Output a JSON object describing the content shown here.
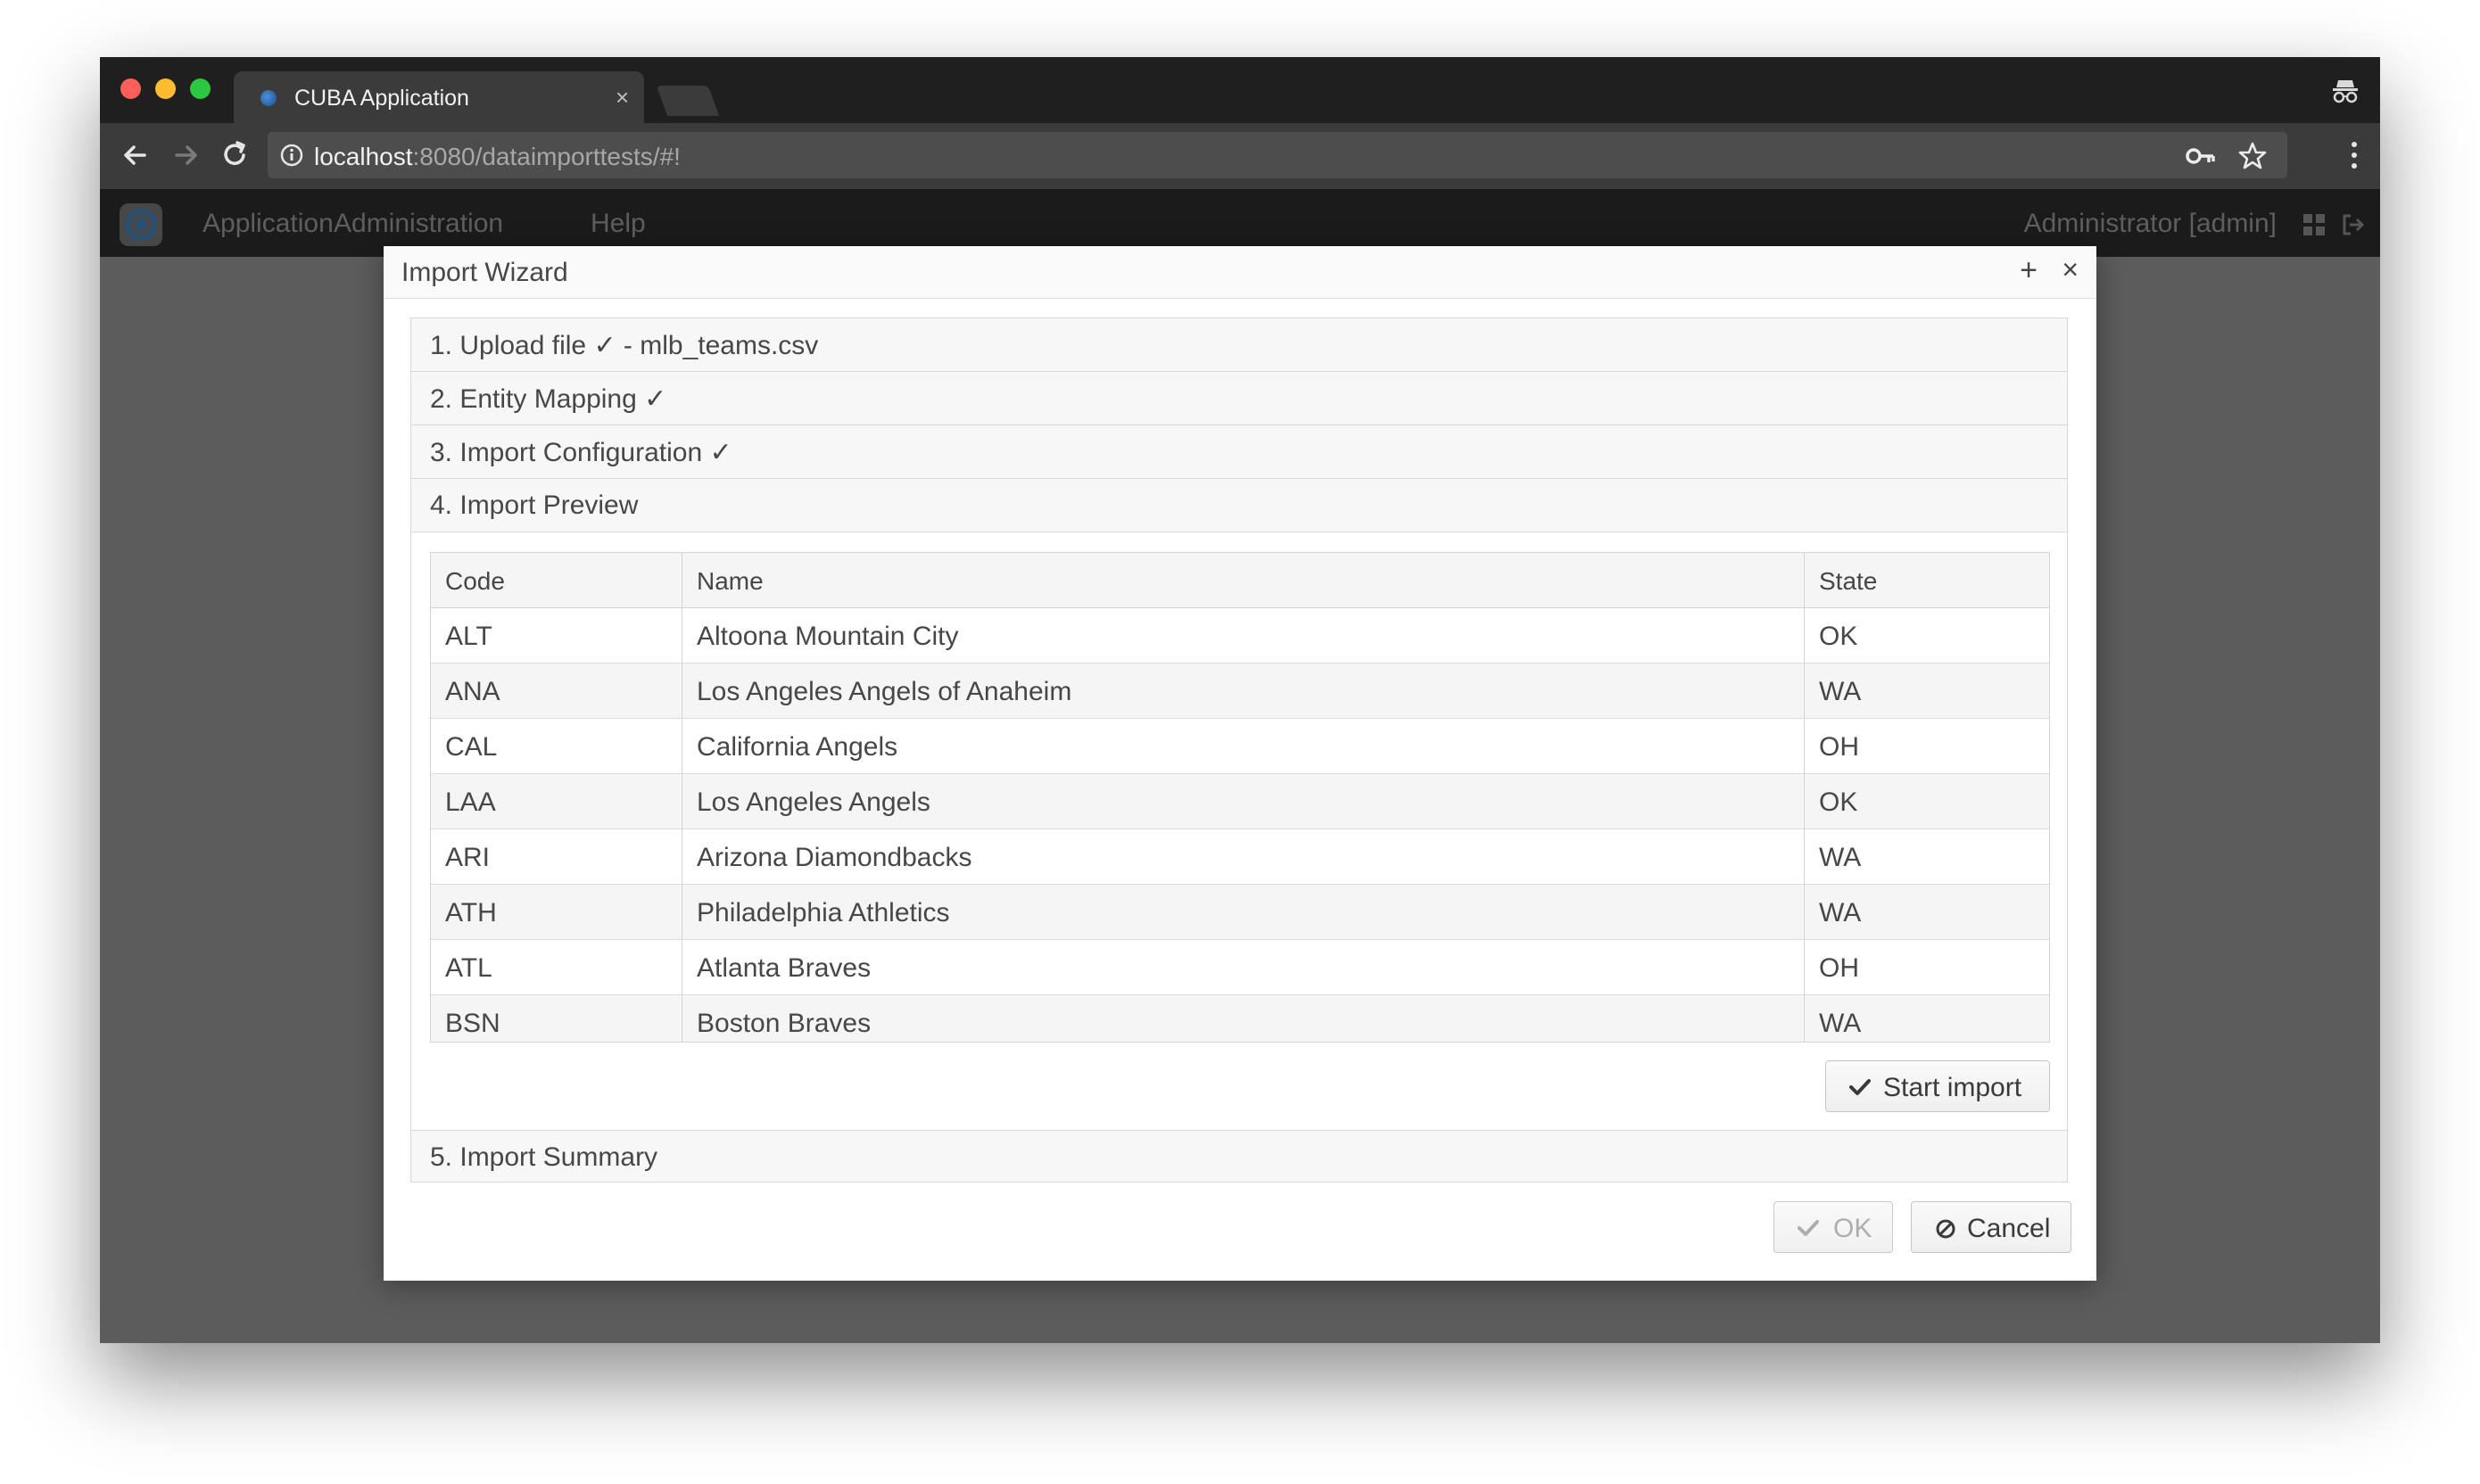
{
  "browser": {
    "tab_title": "CUBA Application",
    "tab_close": "×",
    "url_host": "localhost",
    "url_rest": ":8080/dataimporttests/#!"
  },
  "app": {
    "menu": [
      "Application",
      "Administration",
      "Help"
    ],
    "user": "Administrator [admin]"
  },
  "dialog": {
    "title": "Import Wizard",
    "maximize": "+",
    "close": "×",
    "steps": [
      "1. Upload file ✓ - mlb_teams.csv",
      "2. Entity Mapping ✓",
      "3. Import Configuration ✓",
      "4. Import Preview",
      "5. Import Summary"
    ],
    "table": {
      "columns": [
        "Code",
        "Name",
        "State"
      ],
      "rows": [
        {
          "code": "ALT",
          "name": "Altoona Mountain City",
          "state": "OK"
        },
        {
          "code": "ANA",
          "name": "Los Angeles Angels of Anaheim",
          "state": "WA"
        },
        {
          "code": "CAL",
          "name": "California Angels",
          "state": "OH"
        },
        {
          "code": "LAA",
          "name": "Los Angeles Angels",
          "state": "OK"
        },
        {
          "code": "ARI",
          "name": "Arizona Diamondbacks",
          "state": "WA"
        },
        {
          "code": "ATH",
          "name": "Philadelphia Athletics",
          "state": "WA"
        },
        {
          "code": "ATL",
          "name": "Atlanta Braves",
          "state": "OH"
        },
        {
          "code": "BSN",
          "name": "Boston Braves",
          "state": "WA"
        }
      ]
    },
    "start_import_label": "Start import",
    "ok_label": "OK",
    "cancel_label": "Cancel"
  },
  "icons": {
    "traffic_lights": [
      "#fc5f57",
      "#fdbc2e",
      "#2bc840"
    ],
    "check": "check-icon",
    "cancel": "ban-icon"
  }
}
